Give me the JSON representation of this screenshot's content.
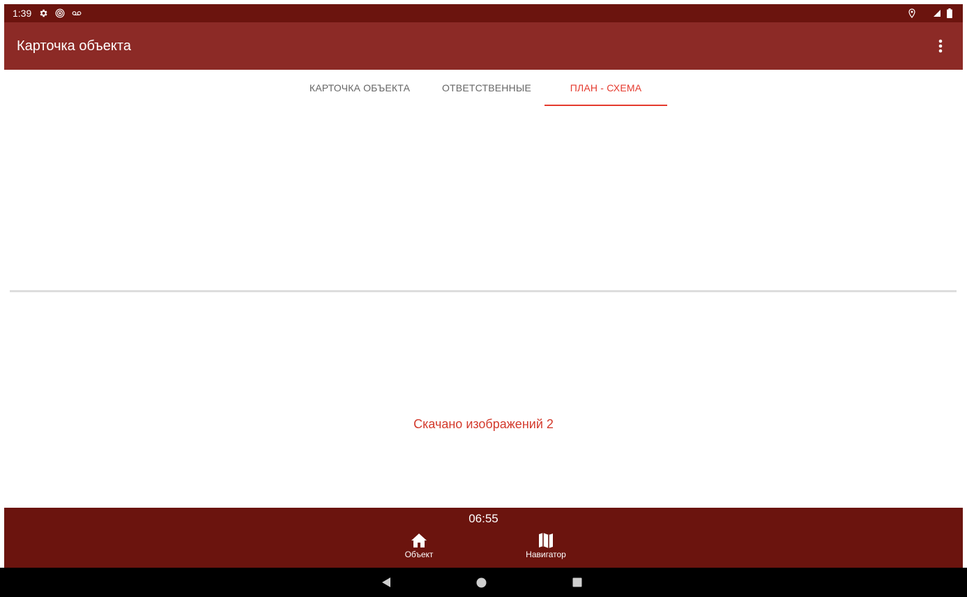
{
  "status_bar": {
    "time": "1:39",
    "left_icons": [
      "gear-icon",
      "hotspot-icon",
      "voicemail-icon"
    ],
    "right_icons": [
      "location-icon",
      "signal-icon",
      "battery-icon"
    ]
  },
  "app_bar": {
    "title": "Карточка объекта",
    "menu_icon": "more-vert-icon"
  },
  "tabs": [
    {
      "label": "КАРТОЧКА ОБЪЕКТА",
      "active": false
    },
    {
      "label": "ОТВЕТСТВЕННЫЕ",
      "active": false
    },
    {
      "label": "ПЛАН - СХЕМА",
      "active": true
    }
  ],
  "content": {
    "download_message": "Скачано изображений 2"
  },
  "bottom_bar": {
    "clock": "06:55",
    "items": [
      {
        "label": "Объект",
        "icon": "home-icon"
      },
      {
        "label": "Навигатор",
        "icon": "map-icon"
      }
    ]
  },
  "system_nav": [
    "back-icon",
    "home-circle-icon",
    "recents-icon"
  ],
  "colors": {
    "status_bar": "#6b140e",
    "app_bar": "#8c2a26",
    "accent": "#e53a2e",
    "bottom_bar": "#6b140e"
  }
}
